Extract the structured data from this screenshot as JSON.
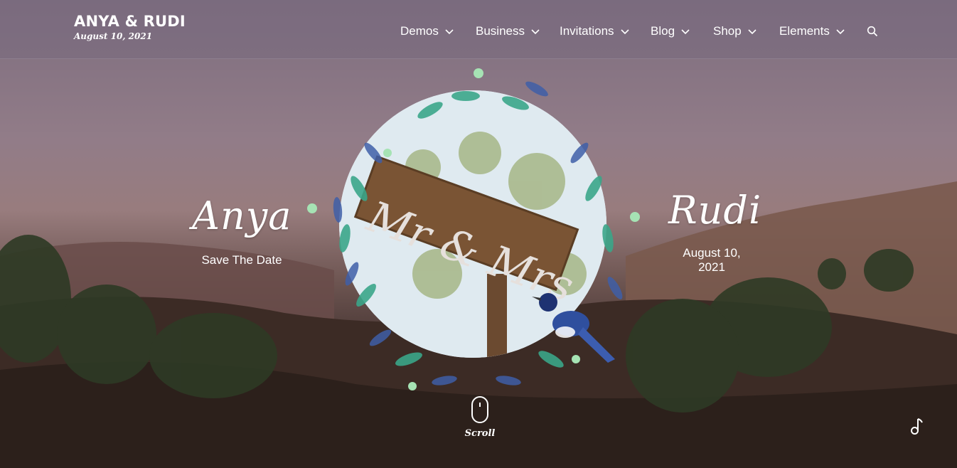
{
  "brand": {
    "title": "ANYA & RUDI",
    "date": "August 10, 2021"
  },
  "nav": {
    "items": [
      {
        "label": "Demos"
      },
      {
        "label": "Business"
      },
      {
        "label": "Invitations"
      },
      {
        "label": "Blog"
      },
      {
        "label": "Shop"
      },
      {
        "label": "Elements"
      }
    ],
    "search_icon": "search-icon",
    "dropdown_icon": "chevron-down-icon"
  },
  "hero": {
    "bride_name": "Anya",
    "bride_subtitle": "Save The Date",
    "groom_name": "Rudi",
    "groom_subtitle_line1": "August 10,",
    "groom_subtitle_line2": "2021",
    "sign_text": "Mr & Mrs"
  },
  "scroll": {
    "label": "Scroll",
    "icon": "mouse-icon"
  },
  "music": {
    "icon": "music-note-icon"
  },
  "colors": {
    "overlay": "#7e6e80",
    "text": "#ffffff",
    "leaf_teal": "#3aa68a",
    "leaf_blue": "#3f5fa8"
  }
}
